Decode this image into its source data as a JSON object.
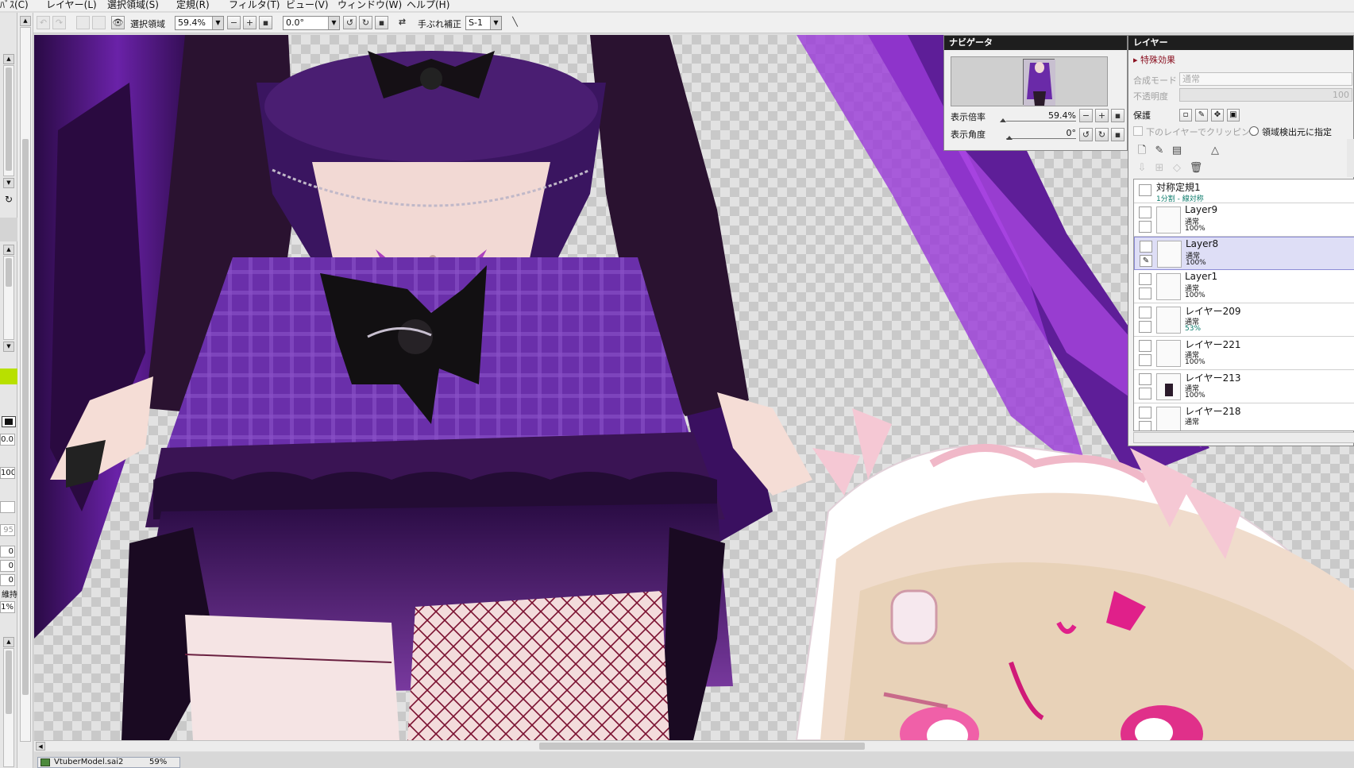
{
  "menubar": {
    "items": [
      "ﾊﾞｽ(C)",
      "レイヤー(L)",
      "選択領域(S)",
      "定規(R)",
      "フィルタ(T)",
      "ビュー(V)",
      "ウィンドウ(W)",
      "ヘルプ(H)"
    ]
  },
  "toolbar": {
    "selection_label": "選択領域",
    "zoom_value": "59.4%",
    "rotation_value": "0.0°",
    "stabilizer_label": "手ぶれ補正",
    "stabilizer_value": "S-1"
  },
  "left_panel": {
    "values": [
      "0.0",
      "100",
      "95",
      "0",
      "0",
      "0",
      "維持",
      "1%"
    ]
  },
  "navigator": {
    "title": "ナビゲータ",
    "zoom_label": "表示倍率",
    "zoom_value": "59.4%",
    "angle_label": "表示角度",
    "angle_value": "0°"
  },
  "layer_panel": {
    "title": "レイヤー",
    "effects_label": "特殊効果",
    "blend_mode_label": "合成モード",
    "blend_mode_value": "通常",
    "opacity_label": "不透明度",
    "opacity_value": "100",
    "protect_label": "保護",
    "clip_label": "下のレイヤーでクリッピング",
    "region_source_label": "領域検出元に指定",
    "layers": [
      {
        "name": "対称定規1",
        "mode": "1分割 - 線対称",
        "opacity": ""
      },
      {
        "name": "Layer9",
        "mode": "通常",
        "opacity": "100%"
      },
      {
        "name": "Layer8",
        "mode": "通常",
        "opacity": "100%"
      },
      {
        "name": "Layer1",
        "mode": "通常",
        "opacity": "100%"
      },
      {
        "name": "レイヤー209",
        "mode": "通常",
        "opacity": "53%"
      },
      {
        "name": "レイヤー221",
        "mode": "通常",
        "opacity": "100%"
      },
      {
        "name": "レイヤー213",
        "mode": "通常",
        "opacity": "100%"
      },
      {
        "name": "レイヤー218",
        "mode": "通常",
        "opacity": ""
      }
    ]
  },
  "status": {
    "filename": "VtuberModel.sai2",
    "zoom": "59%"
  },
  "colors": {
    "accent_green": "#b8e000",
    "dress_purple": "#5a1f8a",
    "ruler_label_teal": "#0a7a6a",
    "selected_layer": "#dedef6"
  }
}
